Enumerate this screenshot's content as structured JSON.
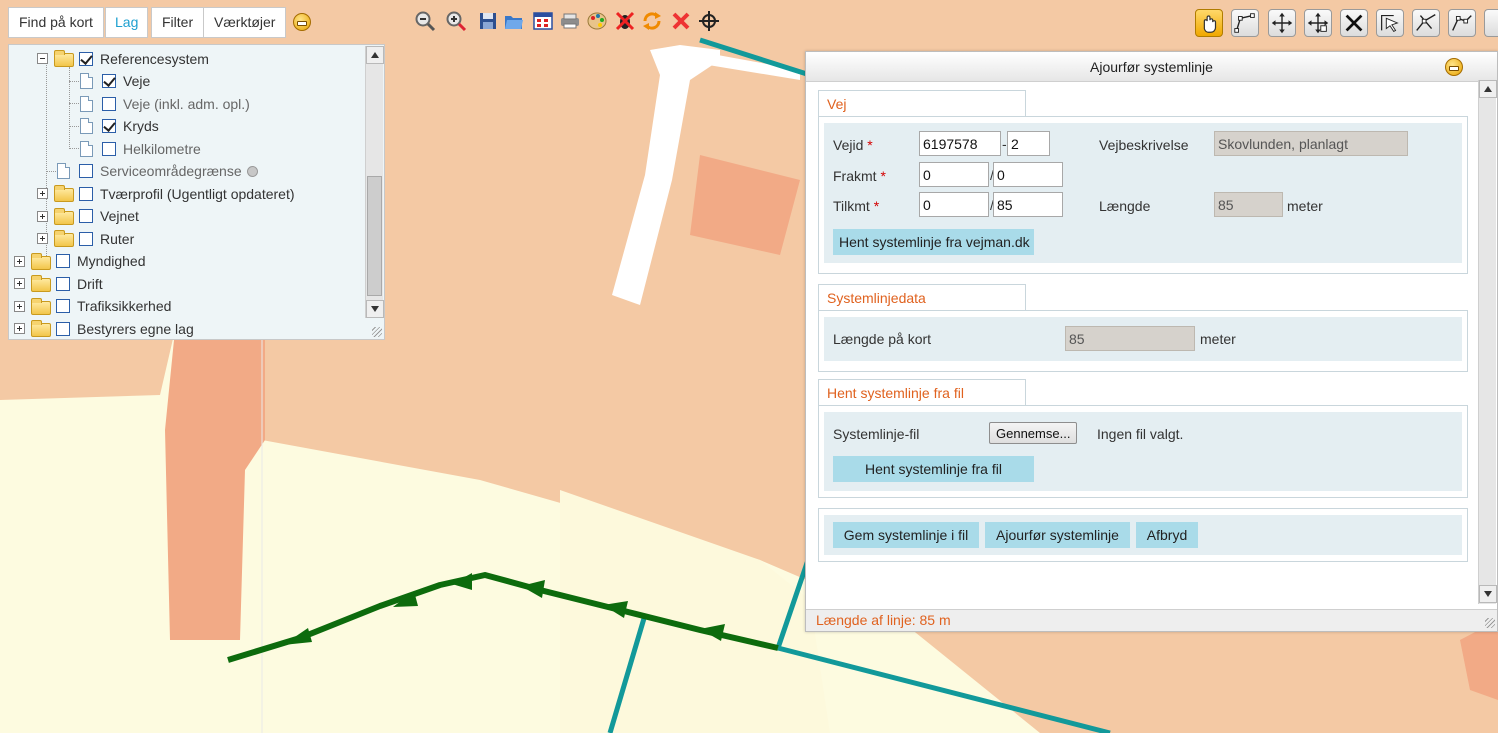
{
  "toolbar": {
    "tabs": [
      {
        "label": "Find på kort"
      },
      {
        "label": "Lag"
      },
      {
        "label": "Filter"
      },
      {
        "label": "Værktøjer"
      }
    ],
    "active_tab": "Lag",
    "accent_color": "#1ea0d0",
    "map_tools": [
      "zoom-out-icon",
      "zoom-in-icon",
      "save-icon",
      "open-folder-icon",
      "table-icon",
      "print-icon",
      "palette-icon",
      "no-bug-icon",
      "refresh-icon",
      "delete-x-icon",
      "crosshair-icon"
    ],
    "edit_tools": [
      "pan-hand-icon",
      "draw-line-icon",
      "move-icon",
      "move-vertex-icon",
      "delete-feature-icon",
      "select-arrow-icon",
      "split-icon",
      "reshape-icon"
    ]
  },
  "layers": {
    "items": [
      {
        "label": "Referencesystem",
        "checked": true
      },
      {
        "label": "Veje",
        "checked": true
      },
      {
        "label": "Veje (inkl. adm. opl.)",
        "checked": false
      },
      {
        "label": "Kryds",
        "checked": true
      },
      {
        "label": "Helkilometre",
        "checked": false
      },
      {
        "label": "Serviceområdegrænse",
        "checked": false
      },
      {
        "label": "Tværprofil (Ugentligt opdateret)",
        "checked": false
      },
      {
        "label": "Vejnet",
        "checked": false
      },
      {
        "label": "Ruter",
        "checked": false
      },
      {
        "label": "Myndighed",
        "checked": false
      },
      {
        "label": "Drift",
        "checked": false
      },
      {
        "label": "Trafiksikkerhed",
        "checked": false
      },
      {
        "label": "Bestyrers egne lag",
        "checked": false
      }
    ]
  },
  "dialog": {
    "title": "Ajourfør systemlinje",
    "vej": {
      "legend": "Vej",
      "vejid_label": "Vejid",
      "vejid_value": "6197578",
      "vejid_suffix": "2",
      "vejid_sep": "-",
      "vejbeskrivelse_label": "Vejbeskrivelse",
      "vejbeskrivelse_value": "Skovlunden, planlagt",
      "frakmt_label": "Frakmt",
      "frakmt_km": "0",
      "frakmt_m": "0",
      "tilkmt_label": "Tilkmt",
      "tilkmt_km": "0",
      "tilkmt_m": "85",
      "slash": "/",
      "laengde_label": "Længde",
      "laengde_value": "85",
      "laengde_unit": "meter",
      "fetch_button": "Hent systemlinje fra vejman.dk",
      "required_mark": "*"
    },
    "systemlinjedata": {
      "legend": "Systemlinjedata",
      "laengde_kort_label": "Længde på kort",
      "laengde_kort_value": "85",
      "unit": "meter"
    },
    "fil": {
      "legend": "Hent systemlinje fra fil",
      "file_label": "Systemlinje-fil",
      "browse_button": "Gennemse...",
      "no_file_text": "Ingen fil valgt.",
      "fetch_button": "Hent systemlinje fra fil"
    },
    "actions": {
      "save_file": "Gem systemlinje i fil",
      "update": "Ajourfør systemlinje",
      "cancel": "Afbryd"
    },
    "status": "Længde af linje: 85 m"
  }
}
